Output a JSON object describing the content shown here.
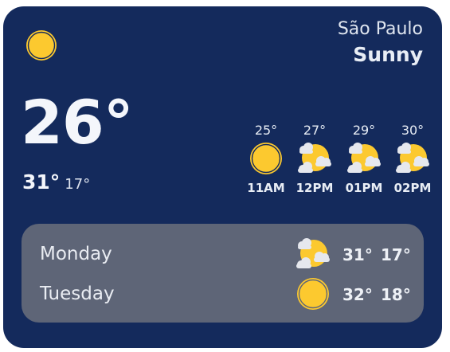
{
  "location": {
    "city": "São Paulo",
    "condition": "Sunny"
  },
  "current": {
    "temp": "26°",
    "high": "31°",
    "low": "17°",
    "icon": "sun-icon"
  },
  "hourly": [
    {
      "temp": "25°",
      "time": "11AM",
      "icon": "sun-icon"
    },
    {
      "temp": "27°",
      "time": "12PM",
      "icon": "partly-cloudy-icon"
    },
    {
      "temp": "29°",
      "time": "01PM",
      "icon": "partly-cloudy-icon"
    },
    {
      "temp": "30°",
      "time": "02PM",
      "icon": "partly-cloudy-icon"
    }
  ],
  "daily": [
    {
      "day": "Monday",
      "high": "31°",
      "low": "17°",
      "icon": "partly-cloudy-icon"
    },
    {
      "day": "Tuesday",
      "high": "32°",
      "low": "18°",
      "icon": "sun-icon"
    }
  ],
  "colors": {
    "card_background": "#142a5c",
    "daily_panel": "#5e6577",
    "sun": "#fcc92f",
    "cloud": "#e6e8ee"
  }
}
